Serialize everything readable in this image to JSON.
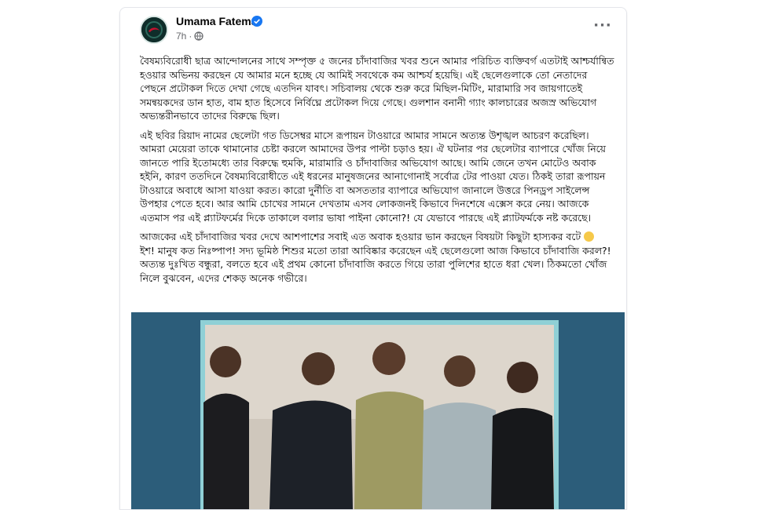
{
  "post": {
    "author": "Umama Fatema",
    "time": "7h",
    "visibility_icon": "globe-icon",
    "verified_icon": "verified-badge-icon",
    "more_icon": "more-options-icon",
    "paragraphs": [
      "বৈষম্যবিরোধী ছাত্র আন্দোলনের সাথে সম্পৃক্ত ৫ জনের চাঁদাবাজির খবর শুনে আমার পরিচিত ব্যক্তিবর্গ এতটাই আশ্চর্যান্বিত হওয়ার অভিনয় করছেন যে আমার মনে হচ্ছে যে আমিই সবথেকে কম আশ্চর্য হয়েছি। এই ছেলেগুলাকে তো নেতাদের পেছনে প্রটোকল দিতে দেখা গেছে এতদিন যাবৎ। সচিবালয় থেকে শুরু করে মিছিল-মিটিং, মারামারি সব জায়গাতেই সমন্বয়কদের ডান হাত, বাম হাত হিসেবে নির্বিঘ্নে প্রটোকল দিয়ে গেছে। গুলশান বনানী গ্যাং কালচারের অজস্র অভিযোগ অভ্যন্তরীনভাবে তাদের বিরুদ্ধে ছিল।",
      "এই ছবির রিয়াদ নামের ছেলেটা গত ডিসেম্বর মাসে রূপায়ন টাওয়ারে আমার সামনে অত্যন্ত উশৃঙ্খল আচরণ করেছিল। আমরা মেয়েরা তাকে থামানোর চেষ্টা করলে আমাদের উপর পাল্টা চড়াও হয়। ঐ ঘটনার পর ছেলেটার ব্যাপারে খোঁজ নিয়ে জানতে পারি ইতোমধ্যে তার বিরুদ্ধে হুমকি, মারামারি ও চাঁদাবাজির অভিযোগ আছে। আমি জেনে তখন মোটেও অবাক হইনি, কারণ ততদিনে বৈষম্যবিরোধীতে এই ধরনের মানুষজনের আনাগোনাই সর্বোত্র টের পাওয়া যেত। ঠিকই তারা রূপায়ন টাওয়ারে অবাধে আসা যাওয়া করত। কারো দুর্নীতি বা অসততার ব্যাপারে অভিযোগ জানালে উত্তরে পিনড্রপ সাইলেন্স উপহার পেতে হবে। আর আমি চোখের সামনে দেখতাম এসব লোকজনই কিভাবে দিনশেষে এক্সেস করে নেয়। আজকে এতমাস পর এই প্ল্যাটফর্মের দিকে তাকালে বলার ভাষা পাইনা কোনো?! যে যেভাবে পারছে এই প্ল্যাটফর্মকে নষ্ট করেছে।",
      "আজকের এই চাঁদাবাজির খবর দেখে আশপাশের সবাই এত অবাক হওয়ার ভান করছেন বিষয়টা কিছুটা হাস্যকর বটে",
      "ইশ! মানুষ কত নিঃষ্পাপ! সদ্য ভূমিষ্ঠ শিশুর মতো তারা আবিষ্কার করেছেন এই ছেলেগুলো আজ কিভাবে চাঁদাবাজি করল?! অত্যন্ত দুঃখিত বন্ধুরা, বলতে হবে এই প্রথম কোনো চাঁদাবাজি করতে গিয়ে তারা পুলিশের হাতে ধরা খেল। ঠিকমতো খোঁজ নিলে বুঝবেন, এদের শেকড় অনেক গভীরে।"
    ],
    "emoji_icon": "laughing-emoji-icon",
    "photo_alt": "five young men standing against a wall",
    "colors": {
      "accent": "#1877f2",
      "text": "#050505",
      "muted": "#65676b",
      "photo_bg": "#2c5d7a",
      "photo_frame": "#8fd0d6"
    }
  }
}
